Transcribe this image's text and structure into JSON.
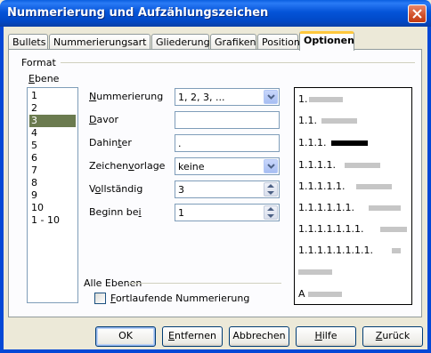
{
  "window": {
    "title": "Nummerierung und Aufzählungszeichen"
  },
  "tabs": [
    {
      "label": "Bullets"
    },
    {
      "label": "Nummerierungsart"
    },
    {
      "label": "Gliederung"
    },
    {
      "label": "Grafiken"
    },
    {
      "label": "Position"
    },
    {
      "label": "Optionen",
      "active": true
    }
  ],
  "format": {
    "group_label": "Format",
    "level_label_rest": "bene",
    "level_label_underlined": "E",
    "levels": [
      "1",
      "2",
      "3",
      "4",
      "5",
      "6",
      "7",
      "8",
      "9",
      "10",
      "1 - 10"
    ],
    "selected_level": "3",
    "fields": {
      "nummerierung": {
        "label_ul": "N",
        "label_rest": "ummerierung",
        "value": "1, 2, 3, ..."
      },
      "davor": {
        "label_ul": "D",
        "label_rest": "avor",
        "value": ""
      },
      "dahinter": {
        "label_pre": "Dahin",
        "label_ul": "t",
        "label_rest": "er",
        "value": "."
      },
      "zeichenvorlage": {
        "label_pre": "Zeichen",
        "label_ul": "v",
        "label_rest": "orlage",
        "value": "keine"
      },
      "vollstaendig": {
        "label_pre": "V",
        "label_ul": "o",
        "label_rest": "llständig",
        "value": "3"
      },
      "beginn": {
        "label_pre": "Beginn be",
        "label_ul": "i",
        "label_rest": "",
        "value": "1"
      }
    },
    "preview_rows": [
      "1.",
      "1.1.",
      "1.1.1.",
      "1.1.1.1.",
      "1.1.1.1.1.",
      "1.1.1.1.1.1.",
      "1.1.1.1.1.1.1.",
      "1.1.1.1.1.1.1.1.",
      "",
      "A"
    ]
  },
  "alle_ebenen": {
    "group_label": "Alle Ebenen",
    "checkbox_label_ul": "F",
    "checkbox_label_rest": "ortlaufende Nummerierung",
    "checked": false
  },
  "buttons": {
    "ok": "OK",
    "entfernen": {
      "ul": "E",
      "rest": "ntfernen"
    },
    "abbrechen": "Abbrechen",
    "hilfe": {
      "ul": "H",
      "rest": "ilfe"
    },
    "zurueck": {
      "ul": "Z",
      "rest": "urück"
    }
  }
}
